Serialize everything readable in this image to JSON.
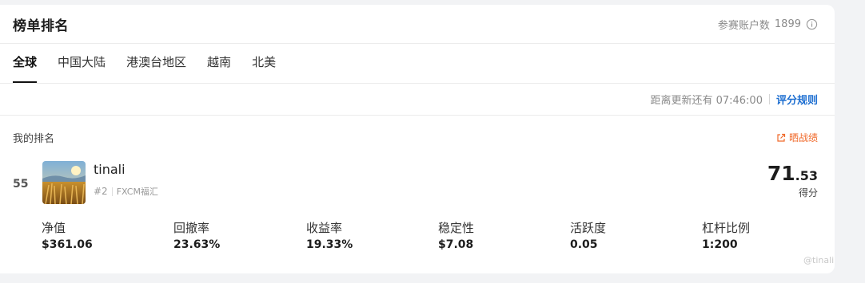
{
  "header": {
    "title": "榜单排名",
    "accounts_label": "参赛账户数",
    "accounts_count": "1899"
  },
  "tabs": [
    "全球",
    "中国大陆",
    "港澳台地区",
    "越南",
    "北美"
  ],
  "update_bar": {
    "text": "距离更新还有 07:46:00",
    "rules_link": "评分规则"
  },
  "my_rank": {
    "label": "我的排名",
    "share_label": "晒战绩",
    "rank": "55",
    "username": "tinali",
    "sub_rank": "#2",
    "broker": "FXCM福汇",
    "score_int": "71",
    "score_dec": ".53",
    "score_label": "得分"
  },
  "stats": [
    {
      "label": "净值",
      "value": "$361.06"
    },
    {
      "label": "回撤率",
      "value": "23.63%"
    },
    {
      "label": "收益率",
      "value": "19.33%"
    },
    {
      "label": "稳定性",
      "value": "$7.08"
    },
    {
      "label": "活跃度",
      "value": "0.05"
    },
    {
      "label": "杠杆比例",
      "value": "1:200"
    }
  ],
  "watermark": "@tinali",
  "colors": {
    "accent_link": "#1e6fd1",
    "share": "#f06a2b",
    "background": "#f2f3f5"
  }
}
